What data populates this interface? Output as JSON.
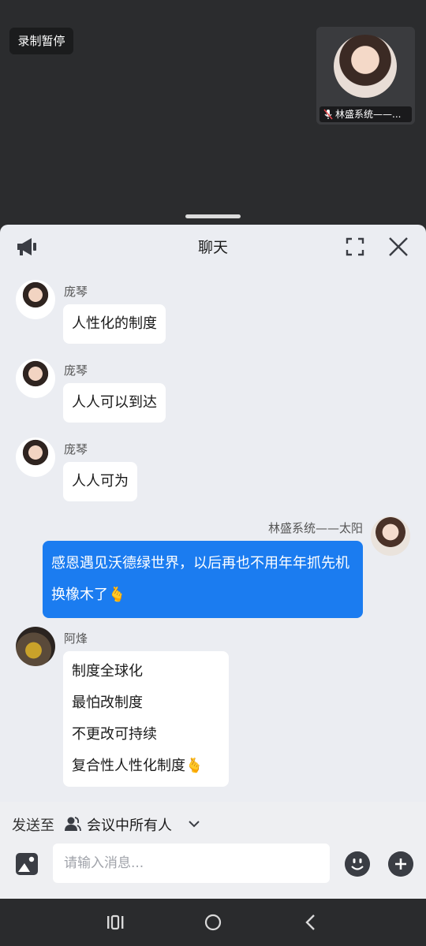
{
  "meeting": {
    "recording_label": "录制暂停",
    "video_tile_name": "林盛系统——..."
  },
  "chat": {
    "title": "聊天",
    "messages": [
      {
        "sender": "庞琴",
        "lines": [
          "人性化的制度"
        ]
      },
      {
        "sender": "庞琴",
        "lines": [
          "人人可以到达"
        ]
      },
      {
        "sender": "庞琴",
        "lines": [
          "人人可为"
        ]
      },
      {
        "sender": "林盛系统——太阳",
        "text": "感恩遇见沃德绿世界，以后再也不用年年抓先机换橡木了",
        "emoji": "🫰"
      },
      {
        "sender": "阿烽",
        "lines": [
          "制度全球化",
          "最怕改制度",
          "不更改可持续",
          "复合性人性化制度"
        ],
        "emoji": "🫰"
      }
    ]
  },
  "compose": {
    "send_to_label": "发送至",
    "send_to_target": "会议中所有人",
    "input_placeholder": "请输入消息..."
  },
  "icons": {
    "announce": "megaphone-icon",
    "fullscreen": "fullscreen-icon",
    "close": "close-icon",
    "people": "people-icon",
    "image": "image-icon",
    "emoji": "emoji-icon",
    "add": "plus-icon"
  },
  "colors": {
    "my_bubble": "#1b7cf0",
    "panel_bg": "#ebedf2",
    "top_bg": "#2b2c2e"
  }
}
